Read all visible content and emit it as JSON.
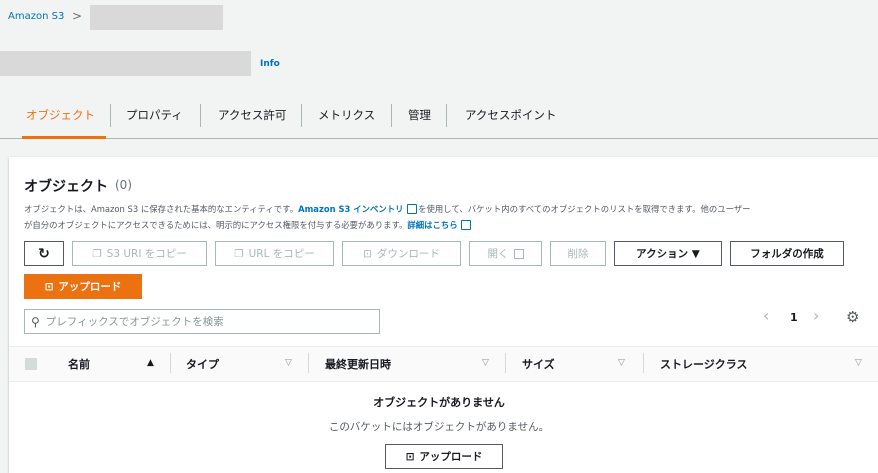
{
  "breadcrumb": {
    "root": "Amazon S3",
    "sep": ">"
  },
  "header": {
    "info": "Info"
  },
  "tabs": [
    {
      "label": "オブジェクト",
      "active": true
    },
    {
      "label": "プロパティ"
    },
    {
      "label": "アクセス許可"
    },
    {
      "label": "メトリクス"
    },
    {
      "label": "管理"
    },
    {
      "label": "アクセスポイント"
    }
  ],
  "objects": {
    "title": "オブジェクト",
    "count": "(0)",
    "desc1_a": "オブジェクトは、Amazon S3 に保存された基本的なエンティティです。",
    "desc1_link": "Amazon S3 インベントリ",
    "desc1_b": "を使用して、バケット内のすべてのオブジェクトのリストを取得できます。他のユーザー",
    "desc2_a": "が自分のオブジェクトにアクセスできるためには、明示的にアクセス権限を付与する必要があります。",
    "desc2_link": "詳細はこちら"
  },
  "toolbar": {
    "refresh": "↻",
    "copy_s3_uri": "S3 URI をコピー",
    "copy_url": "URL をコピー",
    "download": "ダウンロード",
    "open": "開く",
    "delete": "削除",
    "actions": "アクション ▼",
    "create_folder": "フォルダの作成",
    "upload": "アップロード"
  },
  "search": {
    "placeholder": "プレフィックスでオブジェクトを検索"
  },
  "pager": {
    "prev": "‹",
    "page": "1",
    "next": "›"
  },
  "table": {
    "columns": [
      "名前",
      "タイプ",
      "最終更新日時",
      "サイズ",
      "ストレージクラス"
    ],
    "sort_asc": "▲",
    "sort": "▽"
  },
  "empty": {
    "title": "オブジェクトがありません",
    "subtitle": "このバケットにはオブジェクトがありません。",
    "upload": "アップロード"
  },
  "colors": {
    "accent": "#ec7211",
    "link": "#0073bb"
  }
}
